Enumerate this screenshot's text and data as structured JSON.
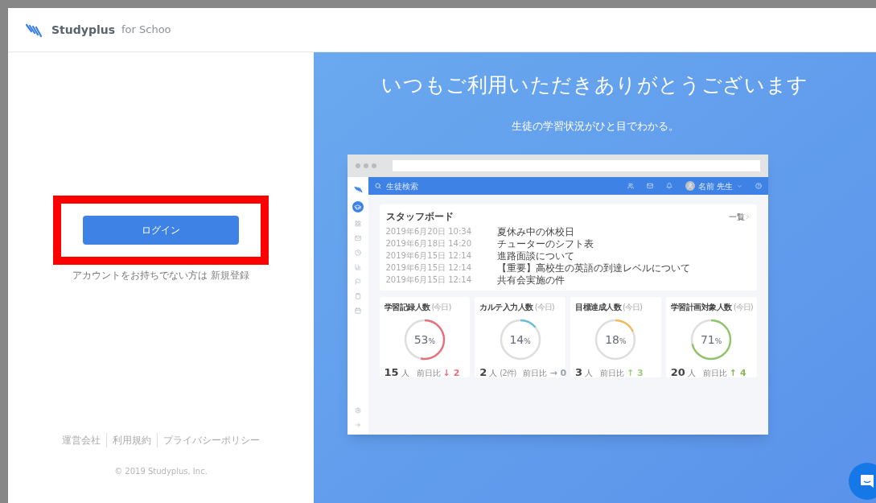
{
  "header": {
    "brand": "Studyplus",
    "brand_suffix": "for Schoo"
  },
  "login": {
    "button": "ログイン",
    "signup_prompt": "アカウントをお持ちでない方は",
    "signup_link": "新規登録"
  },
  "footer": {
    "links": [
      "運営会社",
      "利用規約",
      "プライバシーポリシー"
    ],
    "copyright": "© 2019 Studyplus, Inc."
  },
  "hero": {
    "title": "いつもご利用いただきありがとうございます",
    "subtitle": "生徒の学習状況がひと目でわかる。"
  },
  "mockup": {
    "search_placeholder": "生徒検索",
    "user": "名前 先生",
    "board": {
      "title": "スタッフボード",
      "more": "一覧",
      "items": [
        {
          "date": "2019年6月20日 10:34",
          "title": "夏休み中の休校日"
        },
        {
          "date": "2019年6月18日 14:20",
          "title": "チューターのシフト表"
        },
        {
          "date": "2019年6月15日 12:14",
          "title": "進路面談について"
        },
        {
          "date": "2019年6月15日 12:14",
          "title": "【重要】高校生の英語の到達レベルについて"
        },
        {
          "date": "2019年6月15日 12:14",
          "title": "共有会実施の件"
        }
      ]
    },
    "cards": [
      {
        "title": "学習記録人数",
        "period": "(今日)",
        "level": 0.53,
        "percent": "53",
        "count": "15",
        "unit": "人",
        "compare": "前日比",
        "delta": {
          "text": "↓ 2",
          "color": "#e8707c"
        },
        "color": "#e8707c"
      },
      {
        "title": "カルテ入力人数",
        "period": "(今日)",
        "level": 0.14,
        "percent": "14",
        "count": "2",
        "unit": "人",
        "note": "(2件)",
        "compare": "前日比",
        "delta": {
          "text": "→ 0",
          "color": "#9aa3ad"
        },
        "color": "#6bbcd6"
      },
      {
        "title": "目標達成人数",
        "period": "(今日)",
        "level": 0.18,
        "percent": "18",
        "count": "3",
        "unit": "人",
        "compare": "前日比",
        "delta": {
          "text": "↑ 3",
          "color": "#9ccf7a"
        },
        "color": "#f0b95a"
      },
      {
        "title": "学習計画対象人数",
        "period": "(今日)",
        "level": 0.71,
        "percent": "71",
        "count": "20",
        "unit": "人",
        "compare": "前日比",
        "delta": {
          "text": "↑ 4",
          "color": "#8ab85f"
        },
        "color": "#8fc46a"
      }
    ],
    "percent_sign": "%"
  }
}
